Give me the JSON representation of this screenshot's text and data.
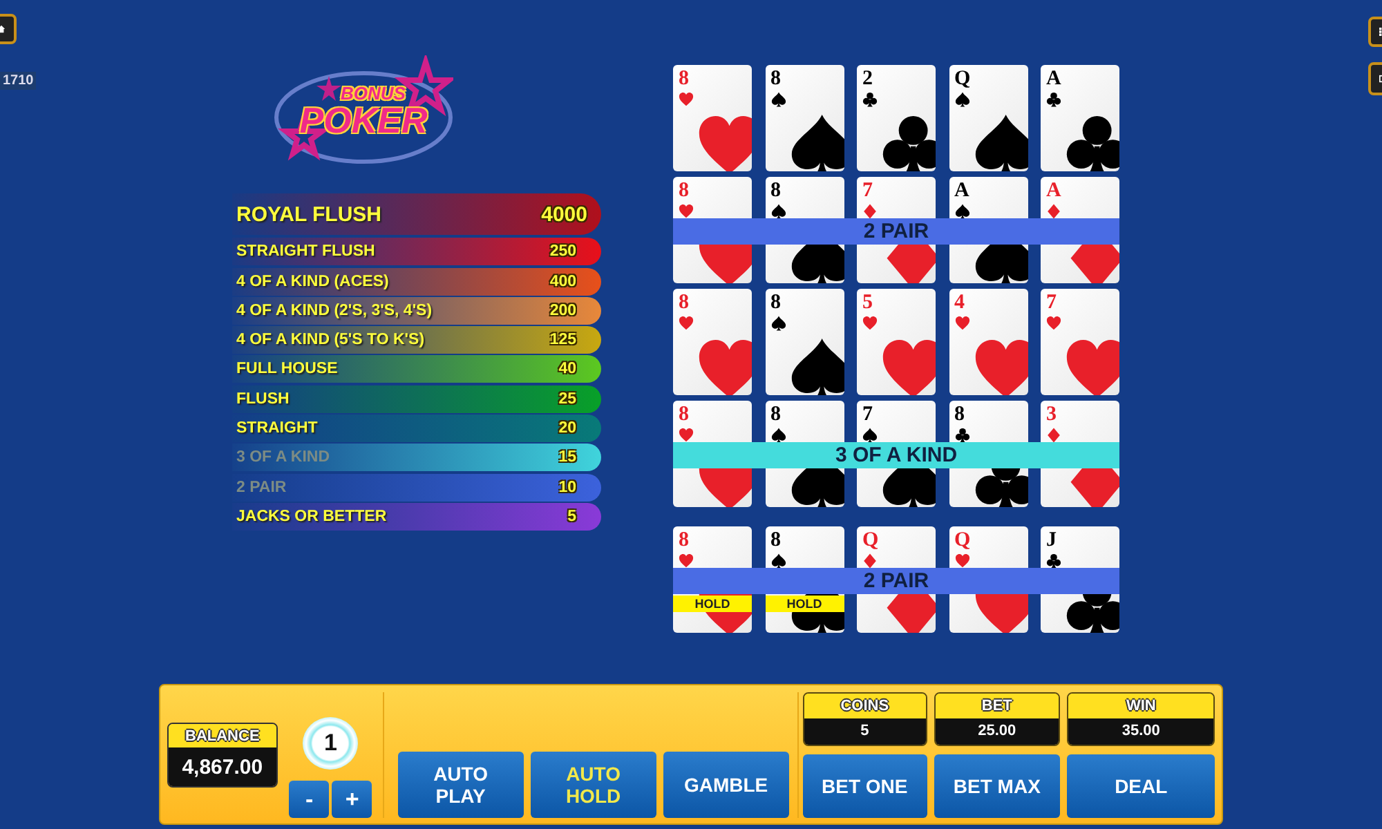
{
  "top_left": {
    "counter": "1710"
  },
  "logo": {
    "line1": "BONUS",
    "line2": "POKER"
  },
  "paytable": [
    {
      "hand": "ROYAL FLUSH",
      "payout": "4000",
      "color": "#b0101c",
      "dimmed": false,
      "kind": "top"
    },
    {
      "hand": "STRAIGHT FLUSH",
      "payout": "250",
      "color": "#e8101a",
      "dimmed": false,
      "kind": "row"
    },
    {
      "hand": "4 OF A KIND (ACES)",
      "payout": "400",
      "color": "#e8501a",
      "dimmed": false,
      "kind": "row"
    },
    {
      "hand": "4 OF A KIND (2'S, 3'S, 4'S)",
      "payout": "200",
      "color": "#e8883a",
      "dimmed": false,
      "kind": "row"
    },
    {
      "hand": "4 OF A KIND (5'S TO K'S)",
      "payout": "125",
      "color": "#c8a810",
      "dimmed": false,
      "kind": "row"
    },
    {
      "hand": "FULL HOUSE",
      "payout": "40",
      "color": "#5cc820",
      "dimmed": false,
      "kind": "row"
    },
    {
      "hand": "FLUSH",
      "payout": "25",
      "color": "#08a028",
      "dimmed": false,
      "kind": "row"
    },
    {
      "hand": "STRAIGHT",
      "payout": "20",
      "color": "#087a78",
      "dimmed": false,
      "kind": "row"
    },
    {
      "hand": "3 OF A KIND",
      "payout": "15",
      "color": "#40d4dc",
      "dimmed": true,
      "kind": "row"
    },
    {
      "hand": "2 PAIR",
      "payout": "10",
      "color": "#3c62dc",
      "dimmed": true,
      "kind": "row"
    },
    {
      "hand": "JACKS OR BETTER",
      "payout": "5",
      "color": "#8a3ad8",
      "dimmed": false,
      "kind": "row"
    }
  ],
  "hands": [
    {
      "cards": [
        {
          "rank": "8",
          "kind": "hearts",
          "held": false
        },
        {
          "rank": "8",
          "kind": "spades",
          "held": false
        },
        {
          "rank": "2",
          "kind": "clubs",
          "held": false
        },
        {
          "rank": "Q",
          "kind": "spades",
          "held": false
        },
        {
          "rank": "A",
          "kind": "clubs",
          "held": false
        }
      ]
    },
    {
      "cards": [
        {
          "rank": "8",
          "kind": "hearts",
          "held": false
        },
        {
          "rank": "8",
          "kind": "spades",
          "held": false
        },
        {
          "rank": "7",
          "kind": "diamonds",
          "held": false
        },
        {
          "rank": "A",
          "kind": "spades",
          "held": false
        },
        {
          "rank": "A",
          "kind": "diamonds",
          "held": false
        }
      ],
      "result": {
        "label": "2 PAIR",
        "color": "#4a6ce4"
      }
    },
    {
      "cards": [
        {
          "rank": "8",
          "kind": "hearts",
          "held": false
        },
        {
          "rank": "8",
          "kind": "spades",
          "held": false
        },
        {
          "rank": "5",
          "kind": "hearts",
          "held": false
        },
        {
          "rank": "4",
          "kind": "hearts",
          "held": false
        },
        {
          "rank": "7",
          "kind": "hearts",
          "held": false
        }
      ]
    },
    {
      "cards": [
        {
          "rank": "8",
          "kind": "hearts",
          "held": false
        },
        {
          "rank": "8",
          "kind": "spades",
          "held": false
        },
        {
          "rank": "7",
          "kind": "spades",
          "held": false
        },
        {
          "rank": "8",
          "kind": "clubs",
          "held": false
        },
        {
          "rank": "3",
          "kind": "diamonds",
          "held": false
        }
      ],
      "result": {
        "label": "3 OF A KIND",
        "color": "#44dcdc"
      }
    },
    {
      "cards": [
        {
          "rank": "8",
          "kind": "hearts",
          "held": true,
          "hold_label": "HOLD"
        },
        {
          "rank": "8",
          "kind": "spades",
          "held": true,
          "hold_label": "HOLD"
        },
        {
          "rank": "Q",
          "kind": "diamonds",
          "held": false
        },
        {
          "rank": "Q",
          "kind": "hearts",
          "held": false
        },
        {
          "rank": "J",
          "kind": "clubs",
          "held": false
        }
      ],
      "result": {
        "label": "2 PAIR",
        "color": "#4a6ce4"
      }
    }
  ],
  "balance": {
    "label": "BALANCE",
    "value": "4,867.00"
  },
  "chip": {
    "value": "1"
  },
  "coin_buttons": [
    "-",
    "+"
  ],
  "buttons": [
    {
      "label": "AUTO PLAY",
      "active": false
    },
    {
      "label": "AUTO HOLD",
      "active": true
    },
    {
      "label": "GAMBLE",
      "active": false
    }
  ],
  "readouts": [
    {
      "label": "COINS",
      "value": "5",
      "button": "BET ONE"
    },
    {
      "label": "BET",
      "value": "25.00",
      "button": "BET MAX"
    },
    {
      "label": "WIN",
      "value": "35.00",
      "button": "DEAL"
    }
  ]
}
